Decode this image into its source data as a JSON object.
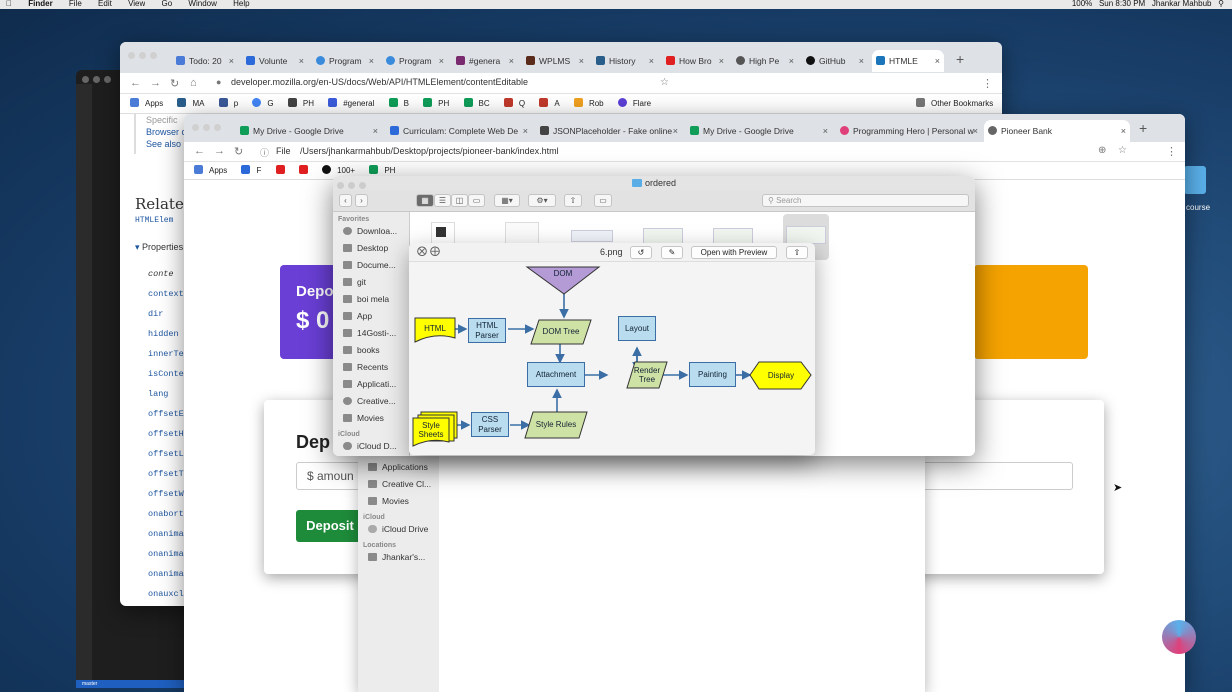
{
  "menubar": {
    "app": "Finder",
    "items": [
      "File",
      "Edit",
      "View",
      "Go",
      "Window",
      "Help"
    ],
    "clock": "Sun 8:30 PM",
    "user": "Jhankar Mahbub",
    "battery": "100%"
  },
  "mdn_window": {
    "tabs": [
      {
        "label": "Todo: 20"
      },
      {
        "label": "Volunte"
      },
      {
        "label": "Program"
      },
      {
        "label": "Program"
      },
      {
        "label": "#genera"
      },
      {
        "label": "WPLMS"
      },
      {
        "label": "History"
      },
      {
        "label": "How Bro"
      },
      {
        "label": "High Pe"
      },
      {
        "label": "GitHub"
      },
      {
        "label": "HTMLE"
      }
    ],
    "url": "developer.mozilla.org/en-US/docs/Web/API/HTMLElement/contentEditable",
    "bookmarks": [
      "Apps",
      "MA",
      "p",
      "G",
      "PH",
      "#general",
      "B",
      "PH",
      "BC",
      "Q",
      "A",
      "Rob",
      "Flare"
    ],
    "other_bookmarks": "Other Bookmarks",
    "sidebar_top": [
      "Specific",
      "Browser c",
      "See also"
    ],
    "related": "Related",
    "related_sub": "HTMLElem",
    "properties": "Properties",
    "props": [
      "conte",
      "context",
      "dir",
      "hidden",
      "innerTe",
      "isConte",
      "lang",
      "offsetE",
      "offsetH",
      "offsetL",
      "offsetT",
      "offsetW",
      "onabort",
      "onanima",
      "onanima",
      "onanima",
      "onauxcl"
    ],
    "course": "course"
  },
  "bank_window": {
    "tabs": [
      {
        "label": "My Drive - Google Drive"
      },
      {
        "label": "Curriculam: Complete Web De"
      },
      {
        "label": "JSONPlaceholder - Fake online"
      },
      {
        "label": "My Drive - Google Drive"
      },
      {
        "label": "Programming Hero | Personal w"
      },
      {
        "label": "Pioneer Bank"
      }
    ],
    "file_label": "File",
    "url": "/Users/jhankarmahbub/Desktop/projects/pioneer-bank/index.html",
    "bookmarks": [
      "Apps",
      "F",
      "100+",
      "PH"
    ],
    "deposit_title": "Depo",
    "deposit_amount": "$ 0",
    "deposit_heading": "Dep",
    "amount_placeholder": "$ amoun",
    "deposit_button": "Deposit"
  },
  "finder_back": {
    "sidebar": [
      {
        "label": "Applications"
      },
      {
        "label": "Creative Cl..."
      },
      {
        "label": "Movies"
      }
    ],
    "icloud": "iCloud",
    "icloud_drive": "iCloud Drive",
    "locations": "Locations",
    "disk": "Jhankar's..."
  },
  "finder": {
    "title": "ordered",
    "search_placeholder": "Search",
    "favorites": "Favorites",
    "sidebar": [
      {
        "label": "Downloa..."
      },
      {
        "label": "Desktop"
      },
      {
        "label": "Docume..."
      },
      {
        "label": "git"
      },
      {
        "label": "boi mela"
      },
      {
        "label": "App"
      },
      {
        "label": "14Gosti-..."
      },
      {
        "label": "books"
      },
      {
        "label": "Recents"
      },
      {
        "label": "Applicati..."
      },
      {
        "label": "Creative..."
      },
      {
        "label": "Movies"
      }
    ],
    "icloud": "iCloud",
    "icloud_drive": "iCloud D..."
  },
  "quicklook": {
    "filename": "6.png",
    "open_with": "Open with Preview",
    "diagram": {
      "dom": "DOM",
      "html": "HTML",
      "html_parser": "HTML Parser",
      "dom_tree": "DOM Tree",
      "layout": "Layout",
      "attachment": "Attachment",
      "render_tree": "Render Tree",
      "painting": "Painting",
      "display": "Display",
      "style_sheets": "Style Sheets",
      "css_parser": "CSS Parser",
      "style_rules": "Style Rules"
    }
  },
  "colors": {
    "purple": "#6a3fd6",
    "orange": "#f5a300",
    "green": "#1e8b3a",
    "node": "#b9dcef",
    "yellow": "#ffff00",
    "trap": "#b49bd6",
    "para": "#cfe2a6"
  }
}
